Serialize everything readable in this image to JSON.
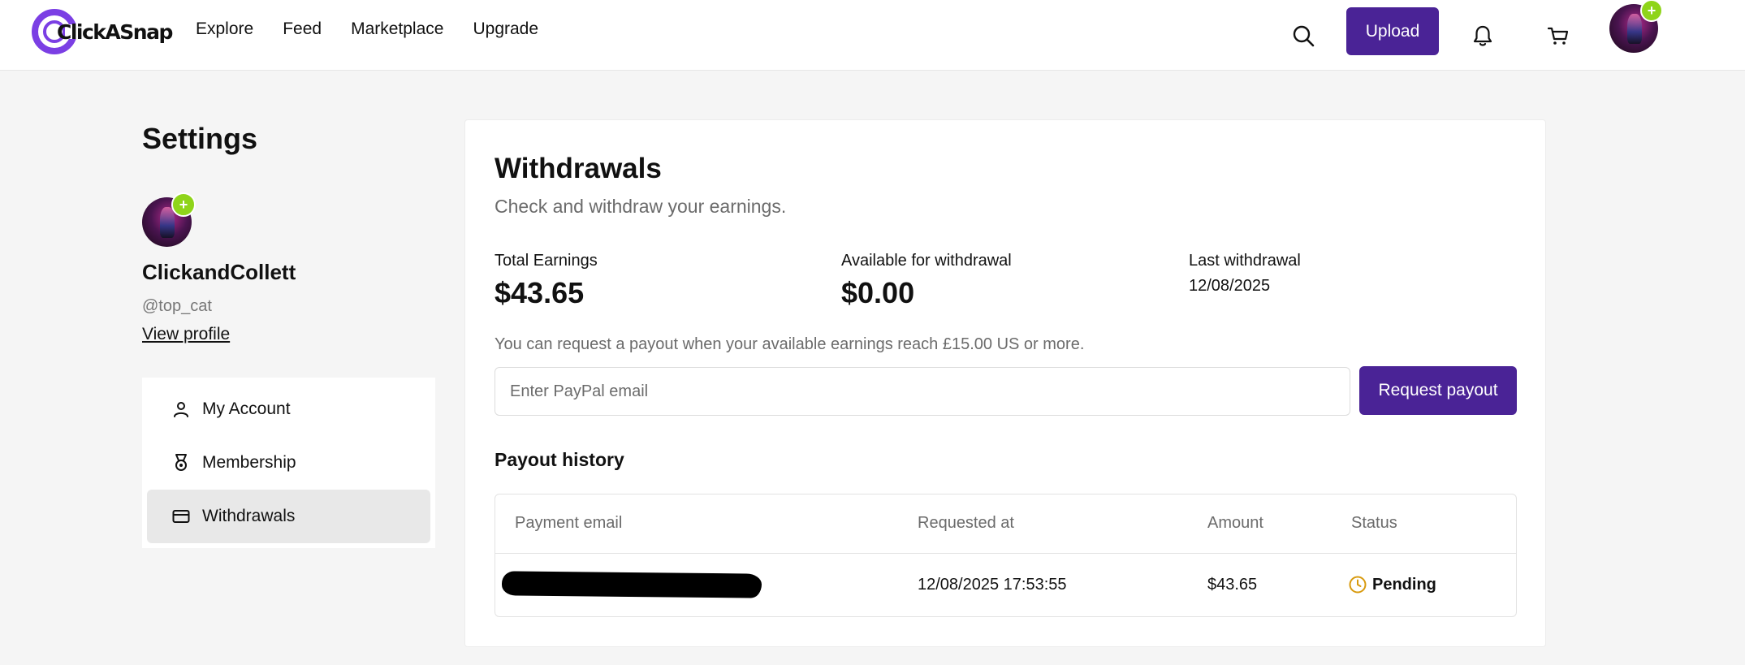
{
  "brand": {
    "name": "ClickASnap",
    "accent": "#4a2396",
    "logo_ring_color": "#7b3fe4",
    "plus_badge_color": "#8fd41a"
  },
  "nav": {
    "links": [
      "Explore",
      "Feed",
      "Marketplace",
      "Upgrade"
    ],
    "search_icon": "search-icon",
    "upload_label": "Upload",
    "notifications_icon": "bell-icon",
    "cart_icon": "cart-icon",
    "avatar_badge": "+"
  },
  "sidebar": {
    "title": "Settings",
    "profile": {
      "name": "ClickandCollett",
      "handle": "@top_cat",
      "view_profile_label": "View profile",
      "avatar_badge": "+"
    },
    "items": [
      {
        "label": "My Account",
        "icon": "user-icon",
        "active": false
      },
      {
        "label": "Membership",
        "icon": "medal-icon",
        "active": false
      },
      {
        "label": "Withdrawals",
        "icon": "card-icon",
        "active": true
      }
    ]
  },
  "withdrawals": {
    "title": "Withdrawals",
    "subtitle": "Check and withdraw your earnings.",
    "stats": {
      "total_label": "Total Earnings",
      "total_value": "$43.65",
      "available_label": "Available for withdrawal",
      "available_value": "$0.00",
      "last_label": "Last withdrawal",
      "last_value": "12/08/2025"
    },
    "note": "You can request a payout when your available earnings reach £15.00 US or more.",
    "paypal_placeholder": "Enter PayPal email",
    "paypal_value": "",
    "request_label": "Request payout",
    "history": {
      "title": "Payout history",
      "columns": [
        "Payment email",
        "Requested at",
        "Amount",
        "Status"
      ],
      "rows": [
        {
          "email": "",
          "email_redacted": true,
          "requested_at": "12/08/2025 17:53:55",
          "amount": "$43.65",
          "status": "Pending",
          "status_icon": "clock-icon",
          "status_color": "#d89a0e"
        }
      ]
    }
  }
}
